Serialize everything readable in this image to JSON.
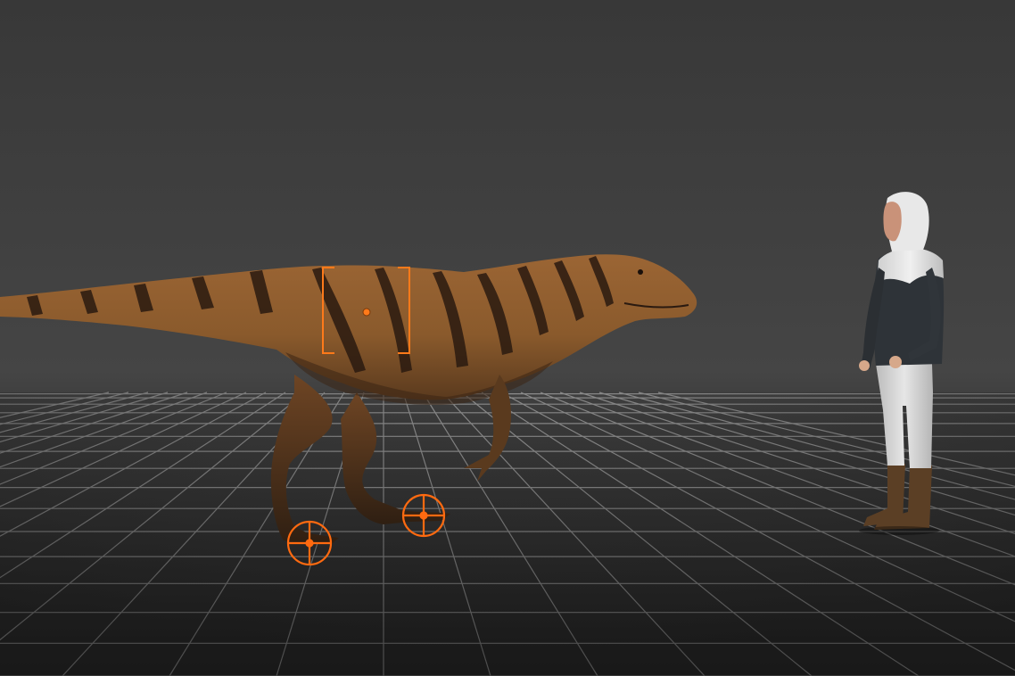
{
  "viewport": {
    "background_top": "#3c3c3c",
    "background_horizon": "#454545",
    "floor_color": "#1e1e1e",
    "grid_color": "#9a9a9a"
  },
  "scene": {
    "dinosaur": {
      "icon": "theropod-dinosaur-model",
      "body_color": "#8c5a2e",
      "stripe_color": "#2a1a10",
      "belly_color": "#b07a45"
    },
    "human": {
      "icon": "human-scale-reference-figure",
      "hoodie_color": "#e3e3e3",
      "jacket_color": "#2e3338",
      "pants_color": "#dcdcdc",
      "boots_color": "#5b3f25"
    },
    "gizmos": {
      "accent_color": "#ff7a1a",
      "hip_handle": "bounding-box-handle",
      "foot_targets": [
        "left-foot-ik-target",
        "right-foot-ik-target"
      ]
    }
  }
}
